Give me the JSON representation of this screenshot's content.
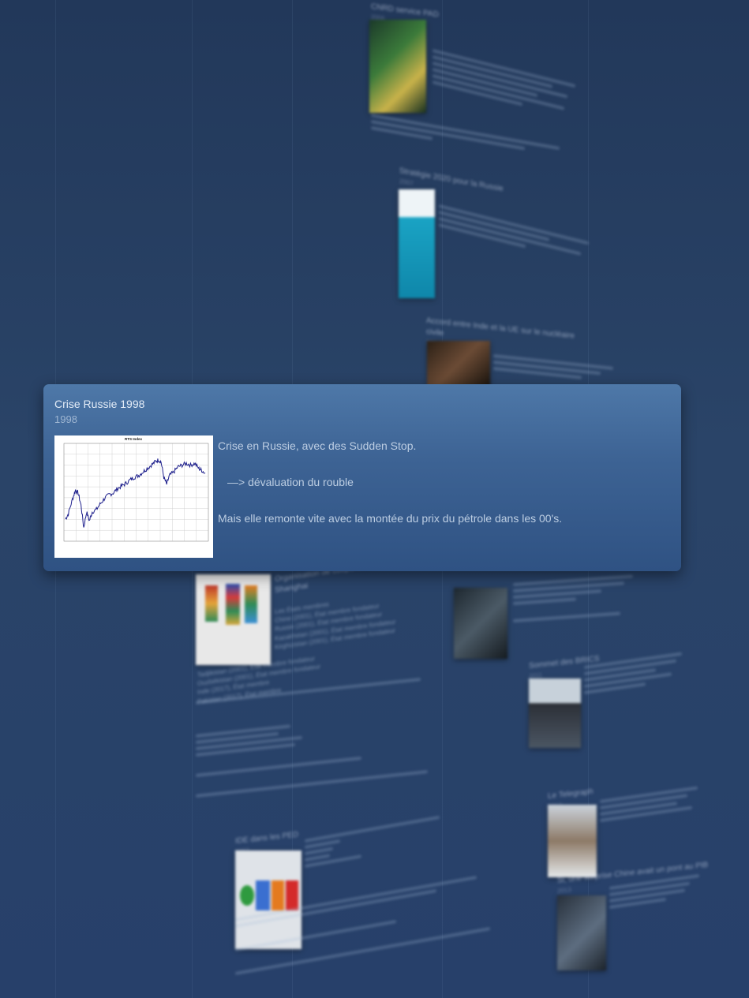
{
  "focused_card": {
    "title": "Crise Russie 1998",
    "date": "1998",
    "image": {
      "chart_title": "RTS Index"
    },
    "lines": [
      "Crise en Russie, avec des Sudden Stop.",
      "—> dévaluation du rouble",
      "Mais elle remonte vite avec la montée du prix du pétrole dans les 00's."
    ]
  },
  "background_items": {
    "top": {
      "title": "CNRD service PAD",
      "date": "2006"
    },
    "strategy": {
      "title": "Stratégie 2020 pour la Russie",
      "date": "2007"
    },
    "accord": {
      "title": "Accord entre Inde et la UE sur le nucléaire civile",
      "date": "2008"
    },
    "sco": {
      "heading": "Organisation de coopération de Shanghai",
      "members_title": "Les États membres",
      "members": [
        "Chine (2001), État membre fondateur",
        "Russie (2001), État membre fondateur",
        "Kazakhstan (2001), État membre fondateur",
        "Kirghizistan (2001), État membre fondateur",
        "Tadjikistan (2001), État membre fondateur",
        "Ouzbékistan (2001), État membre fondateur",
        "Inde (2017), État membre",
        "Pakistan (2017), État membre"
      ]
    },
    "ide": {
      "title": "IDE dans les PED",
      "date": "2002"
    },
    "brics_summit": {
      "title": "Sommet des BRICS",
      "date": "2011"
    },
    "telegraph": {
      "title": "Le Telegraph",
      "date": "2013"
    },
    "china_africa": {
      "title": "Si, une surprise Chine avait un pont au PIB",
      "date": "2013"
    }
  },
  "colors": {
    "card_top": "#4e78a8",
    "card_bottom": "#2f5283",
    "background": "#27406a",
    "chart_line": "#1d1f8c"
  }
}
